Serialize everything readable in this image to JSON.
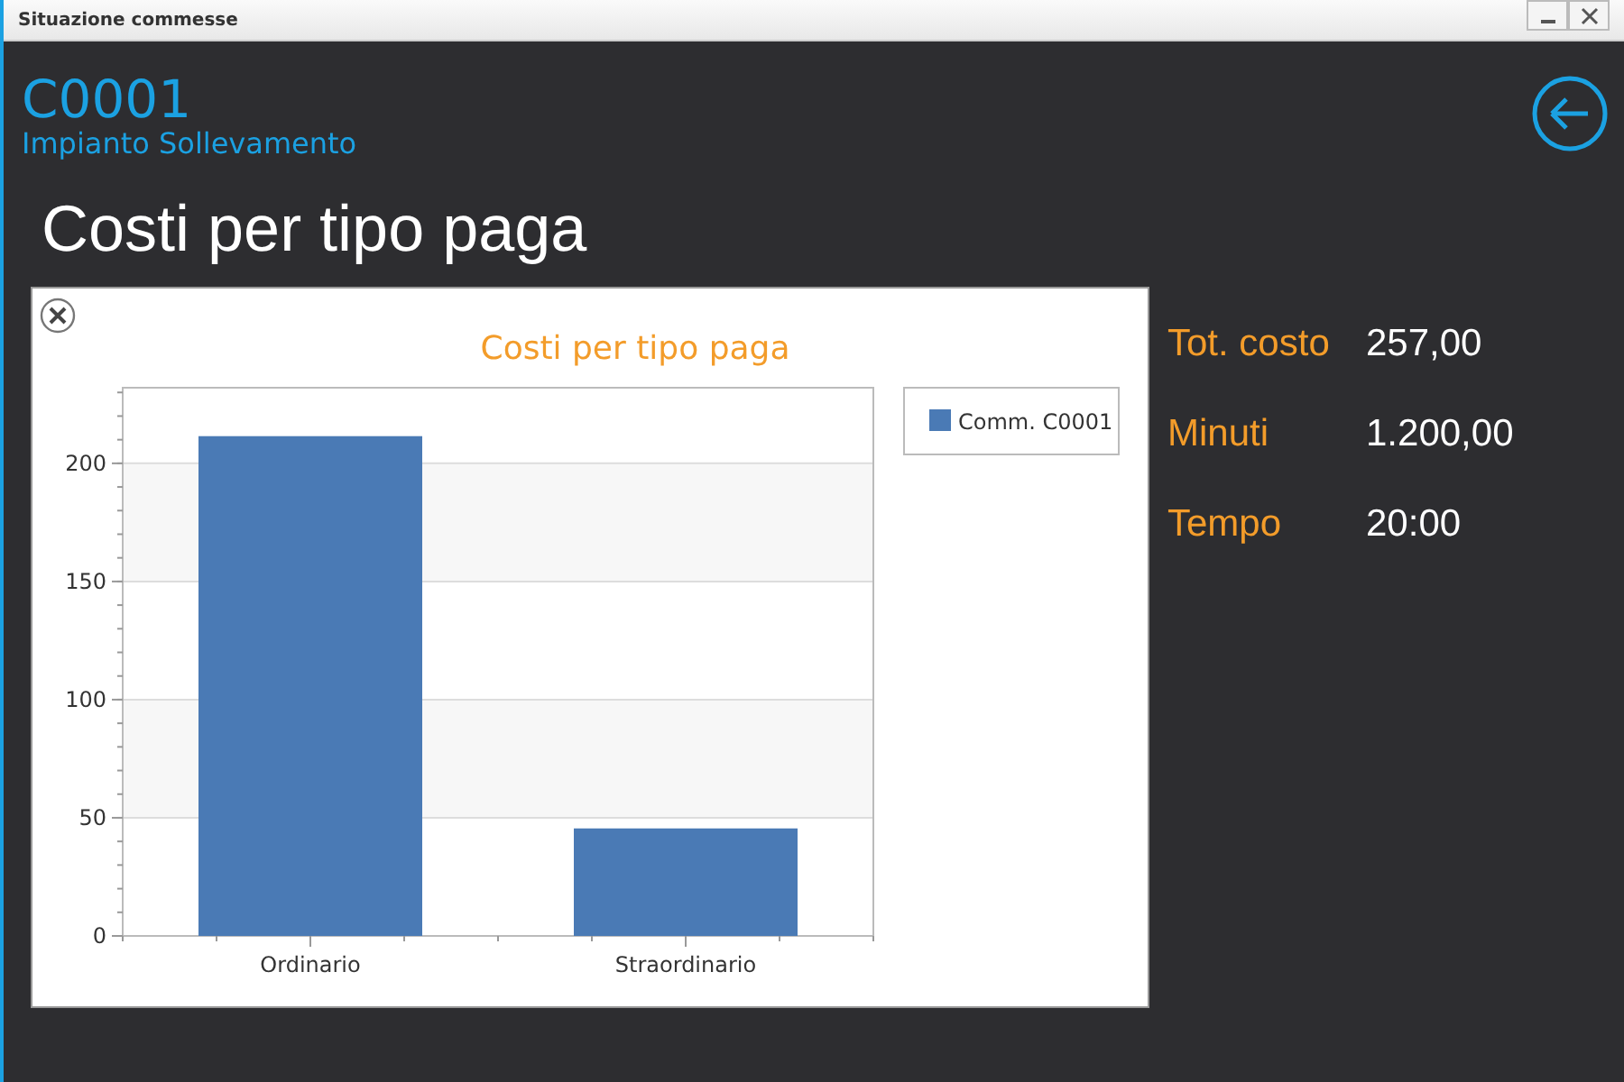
{
  "window": {
    "title": "Situazione commesse"
  },
  "header": {
    "code": "C0001",
    "description": "Impianto Sollevamento"
  },
  "page_title": "Costi per tipo paga",
  "chart": {
    "chart_data": {
      "type": "bar",
      "title": "Costi per tipo paga",
      "categories": [
        "Ordinario",
        "Straordinario"
      ],
      "series": [
        {
          "name": "Comm. C0001",
          "color": "#4a7ab5",
          "values": [
            211.5,
            45.5
          ]
        }
      ],
      "ylim": [
        0,
        232
      ],
      "yticks": [
        0,
        50,
        100,
        150,
        200
      ],
      "grid": true
    }
  },
  "stats": [
    {
      "label": "Tot. costo",
      "value": "257,00"
    },
    {
      "label": "Minuti",
      "value": "1.200,00"
    },
    {
      "label": "Tempo",
      "value": "20:00"
    }
  ]
}
